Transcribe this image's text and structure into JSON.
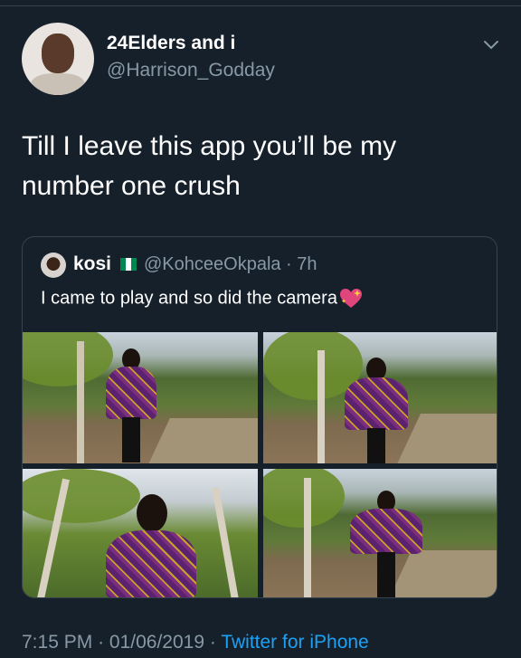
{
  "tweet": {
    "display_name": "24Elders and i",
    "handle": "@Harrison_Godday",
    "text": "Till I leave this app you’ll be my number one crush",
    "time": "7:15 PM",
    "date": "01/06/2019",
    "source": "Twitter for iPhone",
    "separator": "·"
  },
  "quoted": {
    "display_name": "kosi",
    "handle_time": "@KohceeOkpala · 7h",
    "text": "I came to play and so did the camera"
  },
  "icons": {
    "menu": "chevron-down-icon",
    "flag": "nigeria-flag-icon",
    "emoji": "sparkling-heart-icon"
  },
  "colors": {
    "background": "#15202b",
    "secondary_text": "#8899a6",
    "link": "#1da1f2",
    "border": "#38444d"
  }
}
